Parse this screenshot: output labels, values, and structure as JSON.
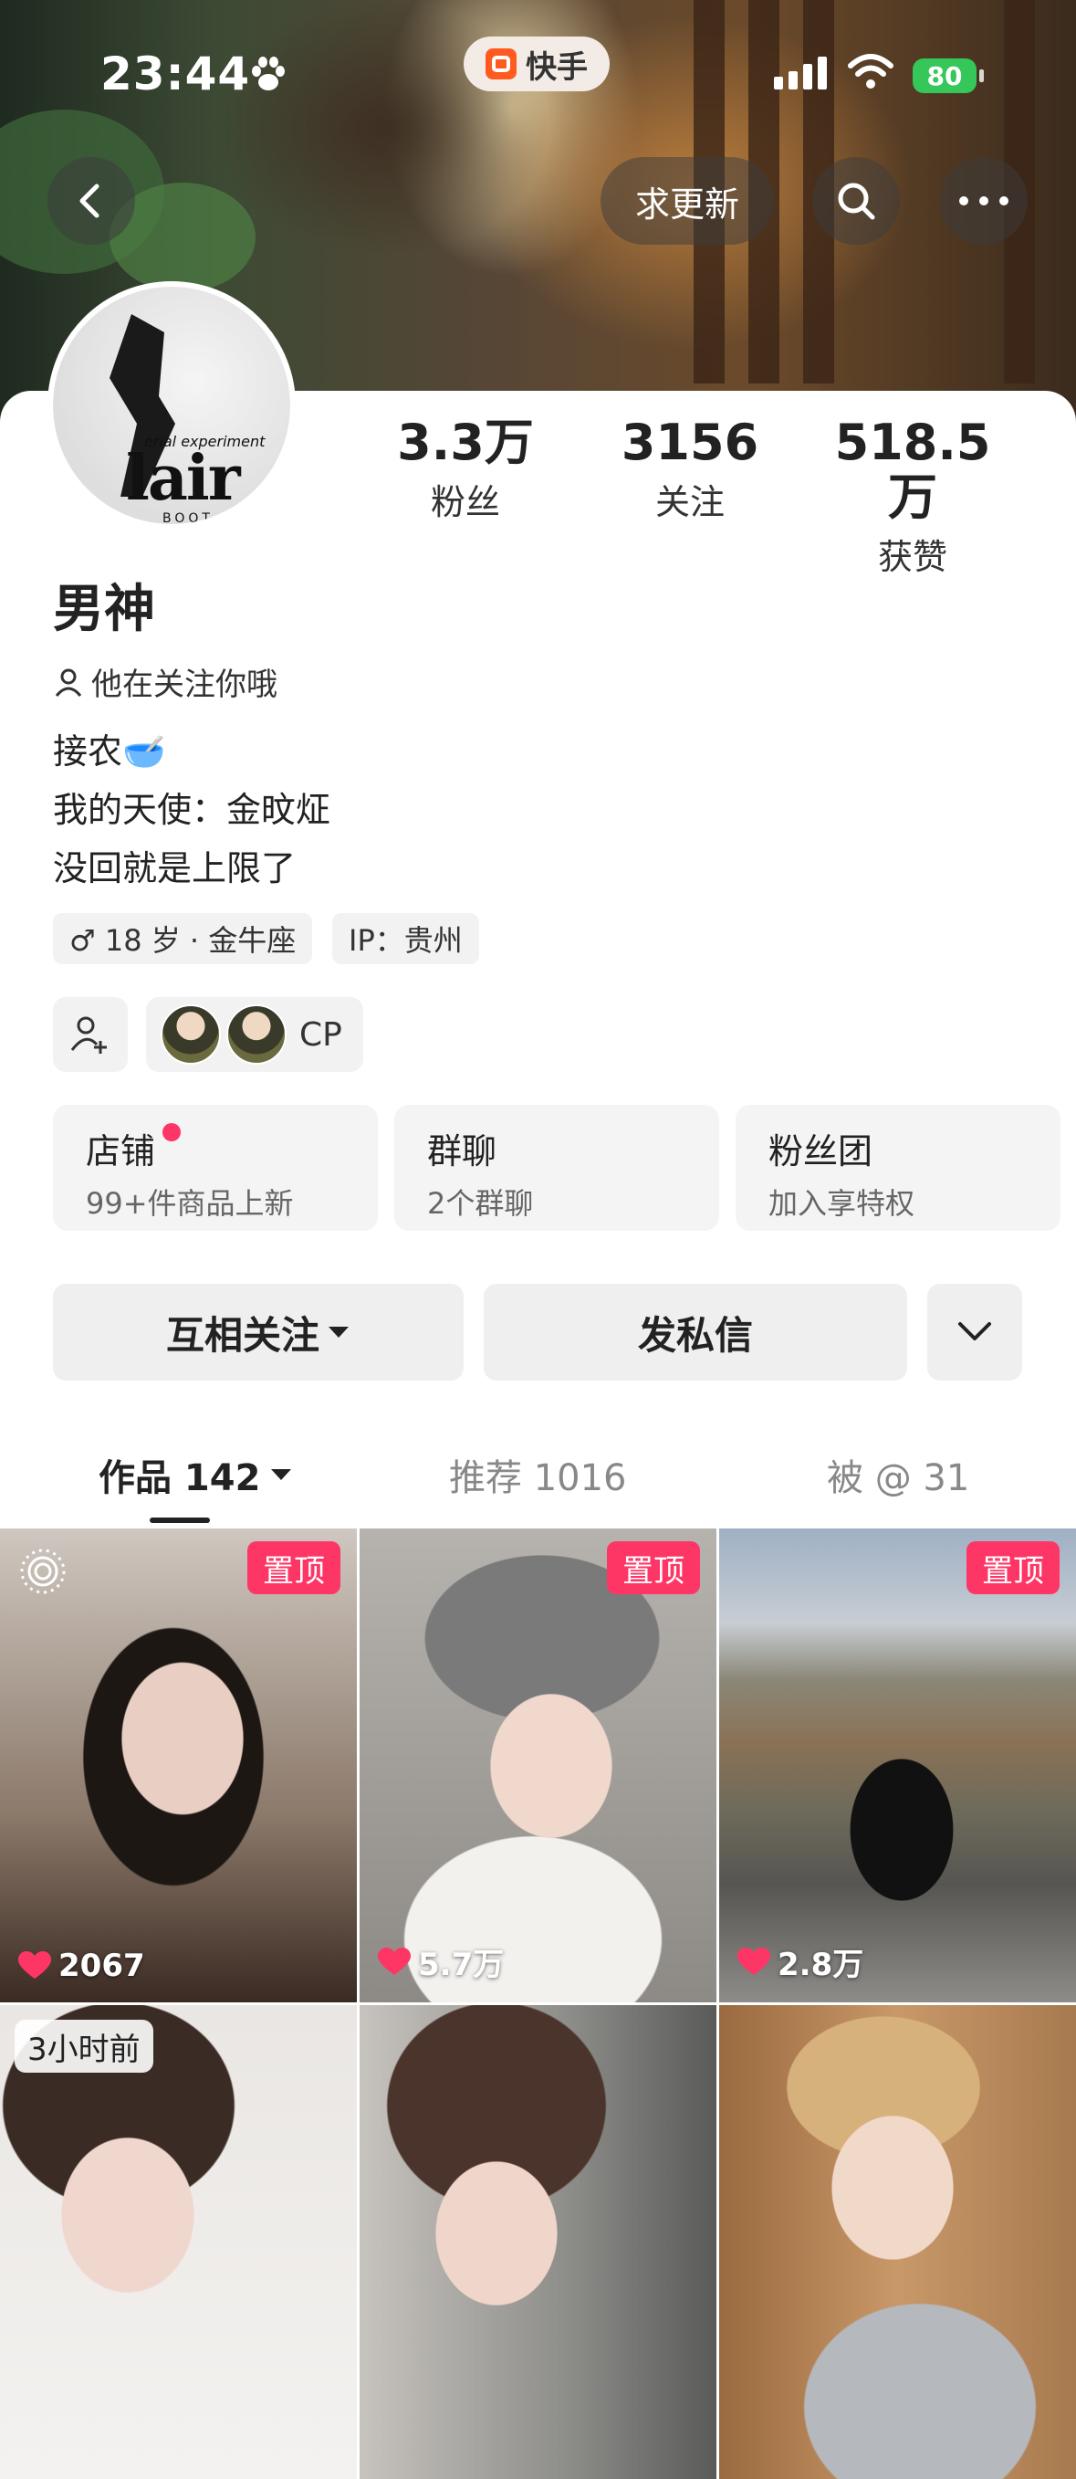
{
  "status_bar": {
    "time": "23:44",
    "app_name": "快手",
    "battery": "80"
  },
  "top_actions": {
    "update_label": "求更新"
  },
  "stats": [
    {
      "value": "3.3万",
      "label": "粉丝"
    },
    {
      "value": "3156",
      "label": "关注"
    },
    {
      "value": "518.5万",
      "label": "获赞"
    }
  ],
  "avatar": {
    "text": "lair",
    "subtext": "erial experiment",
    "bottom": "BOOT"
  },
  "profile": {
    "name": "男神",
    "follows_you": "他在关注你哦",
    "bio": [
      "接农🥣",
      "我的天使：金旼炡",
      "没回就是上限了"
    ],
    "tags": [
      "♂ 18 岁 · 金牛座",
      "IP：贵州"
    ],
    "cp_label": "CP"
  },
  "features": [
    {
      "title": "店铺",
      "subtitle": "99+件商品上新",
      "has_dot": true
    },
    {
      "title": "群聊",
      "subtitle": "2个群聊"
    },
    {
      "title": "粉丝团",
      "subtitle": "加入享特权"
    }
  ],
  "actions": {
    "mutual_follow": "互相关注",
    "message": "发私信"
  },
  "tabs": [
    {
      "label": "作品 142"
    },
    {
      "label": "推荐 1016"
    },
    {
      "label": "被 @ 31"
    }
  ],
  "videos": [
    {
      "pinned": "置顶",
      "likes": "2067"
    },
    {
      "pinned": "置顶",
      "likes": "5.7万"
    },
    {
      "pinned": "置顶",
      "likes": "2.8万"
    },
    {
      "badge": "3小时前"
    },
    {},
    {}
  ],
  "colors": {
    "accent": "#fe3666",
    "battery": "#35c759",
    "app_brand": "#ff5a1f"
  }
}
